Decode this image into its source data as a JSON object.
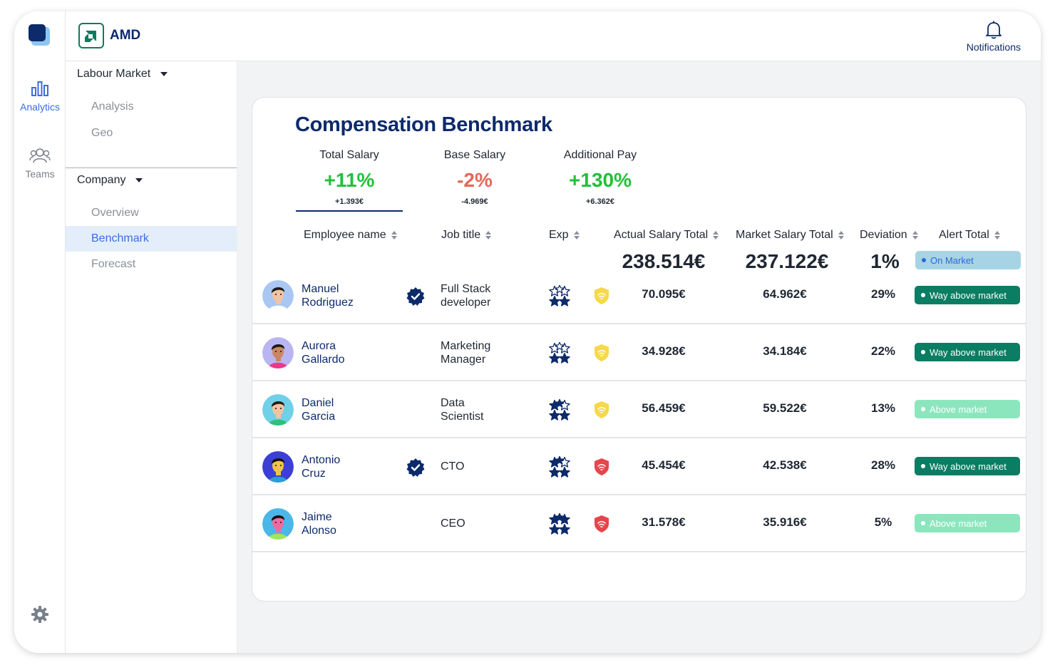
{
  "nav": {
    "analytics": "Analytics",
    "teams": "Teams"
  },
  "header": {
    "brand": "AMD",
    "notifications": "Notifications"
  },
  "subnav": {
    "labour_market": "Labour Market",
    "labour_items": [
      "Analysis",
      "Geo"
    ],
    "company": "Company",
    "company_items": [
      "Overview",
      "Benchmark",
      "Forecast"
    ],
    "active": "Benchmark"
  },
  "card": {
    "title": "Compensation Benchmark",
    "kpis": [
      {
        "label": "Total Salary",
        "value": "+11%",
        "sub": "+1.393€"
      },
      {
        "label": "Base Salary",
        "value": "-2%",
        "sub": "-4.969€"
      },
      {
        "label": "Additional Pay",
        "value": "+130%",
        "sub": "+6.362€"
      }
    ]
  },
  "table": {
    "headers": [
      "Employee name",
      "Job title",
      "Exp",
      "Actual Salary Total",
      "Market Salary Total",
      "Deviation",
      "Alert Total"
    ],
    "totals": {
      "actual": "238.514€",
      "market": "237.122€",
      "deviation": "1%",
      "alert": "On Market"
    },
    "rows": [
      {
        "first": "Manuel",
        "last": "Rodriguez",
        "verified": true,
        "job1": "Full Stack",
        "job2": "developer",
        "stars_filled": 2,
        "shield": "yellow",
        "actual": "70.095€",
        "market": "64.962€",
        "deviation": "29%",
        "alert": "Way above market"
      },
      {
        "first": "Aurora",
        "last": "Gallardo",
        "verified": false,
        "job1": "Marketing",
        "job2": "Manager",
        "stars_filled": 2,
        "shield": "yellow",
        "actual": "34.928€",
        "market": "34.184€",
        "deviation": "22%",
        "alert": "Way above market"
      },
      {
        "first": "Daniel",
        "last": "Garcia",
        "verified": false,
        "job1": "Data",
        "job2": "Scientist",
        "stars_filled": 3,
        "shield": "yellow",
        "actual": "56.459€",
        "market": "59.522€",
        "deviation": "13%",
        "alert": "Above market"
      },
      {
        "first": "Antonio",
        "last": "Cruz",
        "verified": true,
        "job1": "CTO",
        "job2": "",
        "stars_filled": 3,
        "shield": "red",
        "actual": "45.454€",
        "market": "42.538€",
        "deviation": "28%",
        "alert": "Way above market"
      },
      {
        "first": "Jaime",
        "last": "Alonso",
        "verified": false,
        "job1": "CEO",
        "job2": "",
        "stars_filled": 4,
        "shield": "red",
        "actual": "31.578€",
        "market": "35.916€",
        "deviation": "5%",
        "alert": "Above market"
      }
    ]
  },
  "colors": {
    "navy": "#0d2a6b",
    "accent_blue": "#3b6ee0",
    "positive": "#22c03a",
    "negative": "#e4675a",
    "way_above": "#0a7d62",
    "above": "#8ce6bd",
    "on_market": "#a7d4e5"
  }
}
